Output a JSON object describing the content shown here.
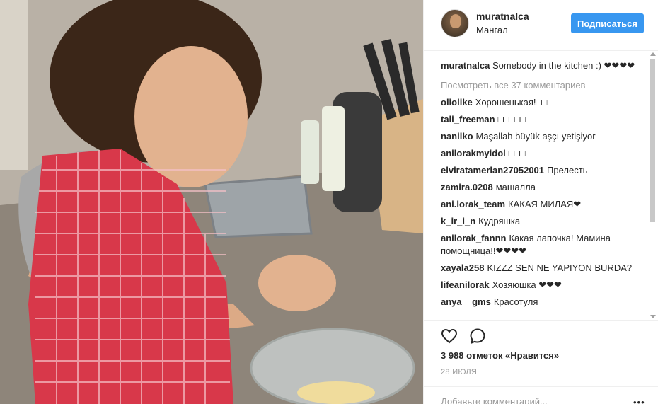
{
  "post": {
    "image_alt": "Girl in red apron cooking in kitchen"
  },
  "header": {
    "username": "muratnalca",
    "location": "Мангал",
    "follow_label": "Подписаться"
  },
  "caption": {
    "username": "muratnalca",
    "text": "Somebody in the kitchen :) ❤❤❤❤"
  },
  "view_all": "Посмотреть все 37 комментариев",
  "comments": [
    {
      "user": "oliolike",
      "text": "Хорошенькая!□□"
    },
    {
      "user": "tali_freeman",
      "text": "□□□□□□"
    },
    {
      "user": "nanilko",
      "text": "Maşallah büyük aşçı yetişiyor"
    },
    {
      "user": "anilorakmyidol",
      "text": "□□□"
    },
    {
      "user": "elviratamerlan27052001",
      "text": "Прелесть"
    },
    {
      "user": "zamira.0208",
      "text": "машалла"
    },
    {
      "user": "ani.lorak_team",
      "text": "КАКАЯ МИЛАЯ❤"
    },
    {
      "user": "k_ir_i_n",
      "text": "Кудряшка"
    },
    {
      "user": "anilorak_fannn",
      "text": "Какая лапочка! Мамина помощница!!❤❤❤❤"
    },
    {
      "user": "xayala258",
      "text": "KIZZZ SEN NE YAPIYON BURDA?"
    },
    {
      "user": "lifeanilorak",
      "text": "Хозяюшка ❤❤❤"
    },
    {
      "user": "anya__gms",
      "text": "Красотуля"
    }
  ],
  "actions": {
    "like_icon": "heart-outline-icon",
    "comment_icon": "speech-bubble-icon"
  },
  "likes": "3 988 отметок «Нравится»",
  "date": "28 ИЮЛЯ",
  "add_comment_placeholder": "Добавьте комментарий...",
  "more_label": "•••"
}
